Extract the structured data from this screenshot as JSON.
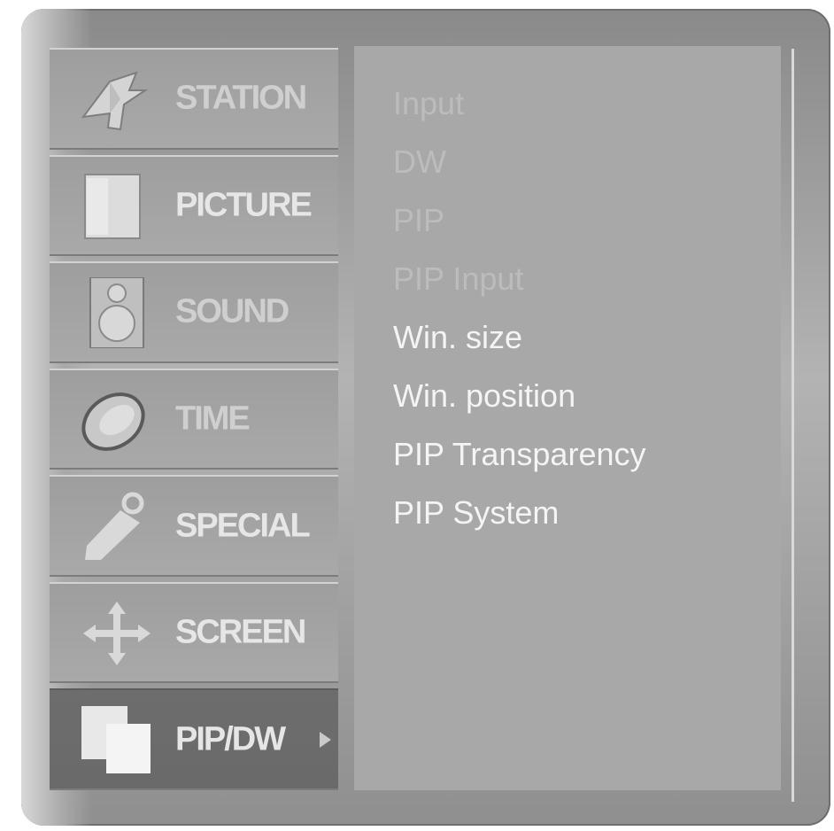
{
  "menu": {
    "items": [
      {
        "label": "STATION",
        "icon": "satellite-icon",
        "state": "dim"
      },
      {
        "label": "PICTURE",
        "icon": "picture-icon",
        "state": "normal"
      },
      {
        "label": "SOUND",
        "icon": "speaker-icon",
        "state": "dim"
      },
      {
        "label": "TIME",
        "icon": "clock-icon",
        "state": "dim"
      },
      {
        "label": "SPECIAL",
        "icon": "key-tag-icon",
        "state": "normal"
      },
      {
        "label": "SCREEN",
        "icon": "four-way-arrows-icon",
        "state": "normal"
      },
      {
        "label": "PIP/DW",
        "icon": "pip-windows-icon",
        "state": "selected"
      }
    ]
  },
  "submenu": {
    "options": [
      {
        "label": "Input",
        "enabled": false
      },
      {
        "label": "DW",
        "enabled": false
      },
      {
        "label": "PIP",
        "enabled": false
      },
      {
        "label": "PIP Input",
        "enabled": false
      },
      {
        "label": "Win. size",
        "enabled": true
      },
      {
        "label": "Win. position",
        "enabled": true
      },
      {
        "label": "PIP Transparency",
        "enabled": true
      },
      {
        "label": "PIP System",
        "enabled": true
      }
    ]
  },
  "colors": {
    "panel": "#a8a8a8",
    "selected_item": "#6d6d6d",
    "text_active": "#f4f4f4",
    "text_disabled": "#bcbcbc"
  }
}
